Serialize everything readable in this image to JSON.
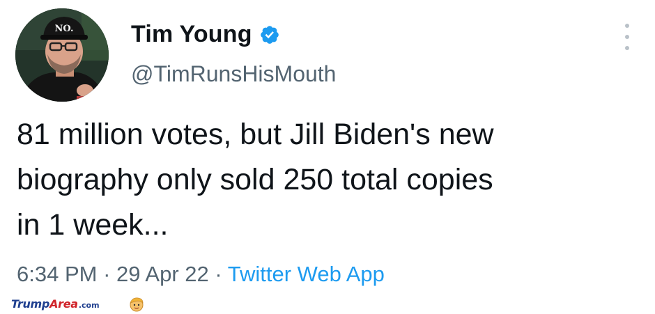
{
  "tweet": {
    "author": {
      "display_name": "Tim Young",
      "handle": "@TimRunsHisMouth",
      "verified": true,
      "avatar_hat_text": "NO."
    },
    "text_lines": [
      "81 million votes, but Jill Biden's new",
      "biography only sold 250 total copies",
      "in 1 week..."
    ],
    "meta": {
      "time": "6:34 PM",
      "separator": " · ",
      "date": "29 Apr 22",
      "source": "Twitter Web App"
    },
    "menu_icon": "more-vertical-icon"
  },
  "watermark": {
    "part1": "Trump",
    "part2": "Area",
    "part3": ".com"
  },
  "colors": {
    "text": "#0f1419",
    "secondary": "#536471",
    "link": "#1d9bf0",
    "verified": "#1d9bf0"
  }
}
